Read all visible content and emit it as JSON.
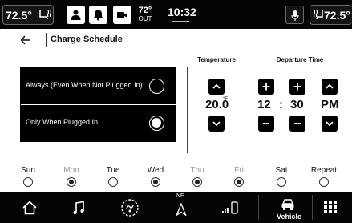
{
  "topbar": {
    "driver_temp": "72.5°",
    "outside_temp": "72°",
    "outside_label": "OUT",
    "clock": "10:32",
    "passenger_temp": "72.5°",
    "icons": [
      "seat-heat-icon",
      "person-icon",
      "bell-icon",
      "camera-icon",
      "microphone-icon"
    ]
  },
  "header": {
    "back_icon": "arrow-left-icon",
    "title": "Charge Schedule"
  },
  "options": [
    {
      "label": "Always (Even When Not Plugged In)",
      "selected": false
    },
    {
      "label": "Only When Plugged In",
      "selected": true
    }
  ],
  "temperature": {
    "title": "Temperature",
    "value": "20.0",
    "unit": "°F"
  },
  "departure": {
    "title": "Departure Time",
    "hour": "12",
    "separator": ":",
    "minute": "30",
    "ampm": "PM"
  },
  "days": [
    {
      "name": "Sun",
      "checked": false,
      "dim": false
    },
    {
      "name": "Mon",
      "checked": true,
      "dim": true
    },
    {
      "name": "Tue",
      "checked": false,
      "dim": false
    },
    {
      "name": "Wed",
      "checked": true,
      "dim": false
    },
    {
      "name": "Thu",
      "checked": true,
      "dim": true
    },
    {
      "name": "Fri",
      "checked": true,
      "dim": true
    },
    {
      "name": "Sat",
      "checked": false,
      "dim": false
    },
    {
      "name": "Repeat",
      "checked": false,
      "dim": false
    }
  ],
  "bottom_nav": {
    "compass": "NE",
    "vehicle_label": "Vehicle",
    "icons": [
      "home-icon",
      "music-icon",
      "hands-free-icon",
      "navigation-icon",
      "phone-signal-icon",
      "vehicle-icon",
      "apps-grid-icon"
    ]
  }
}
